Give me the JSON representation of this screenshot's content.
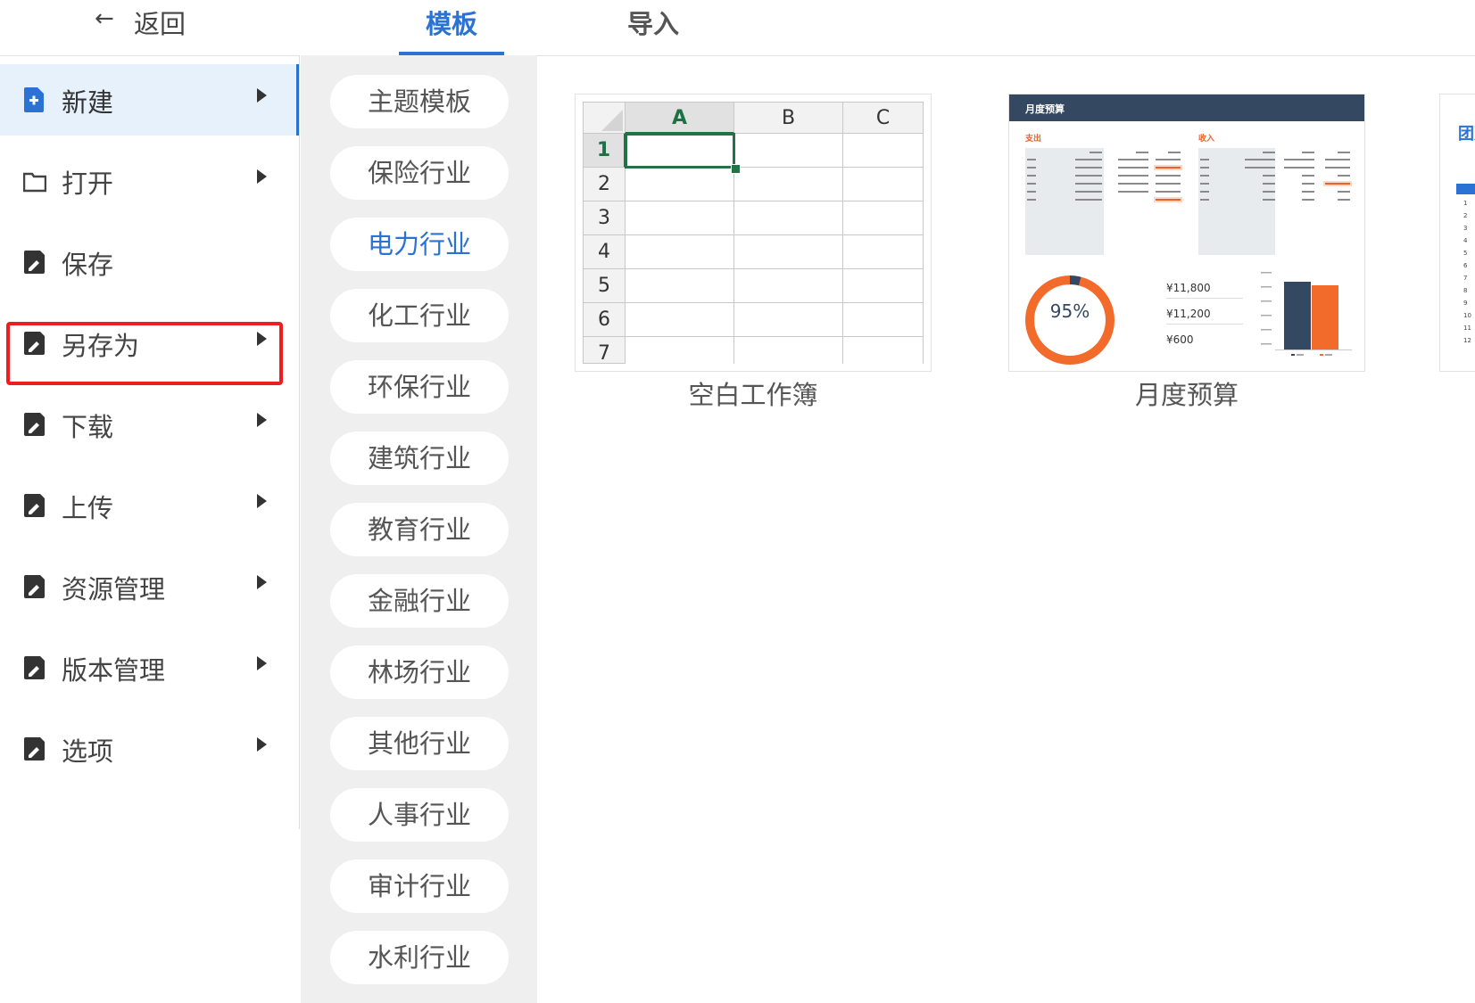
{
  "back": {
    "label": "返回"
  },
  "menu": [
    {
      "label": "新建",
      "icon": "file-add-icon",
      "active": true,
      "has_submenu": true
    },
    {
      "label": "打开",
      "icon": "folder-icon",
      "has_submenu": true
    },
    {
      "label": "保存",
      "icon": "save-icon",
      "has_submenu": false
    },
    {
      "label": "另存为",
      "icon": "save-icon",
      "has_submenu": true,
      "highlighted": true
    },
    {
      "label": "下载",
      "icon": "save-icon",
      "has_submenu": true
    },
    {
      "label": "上传",
      "icon": "save-icon",
      "has_submenu": true
    },
    {
      "label": "资源管理",
      "icon": "save-icon",
      "has_submenu": true
    },
    {
      "label": "版本管理",
      "icon": "save-icon",
      "has_submenu": true
    },
    {
      "label": "选项",
      "icon": "save-icon",
      "has_submenu": true
    }
  ],
  "tabs": {
    "templates": "模板",
    "import": "导入",
    "active": "templates"
  },
  "categories": [
    "主题模板",
    "保险行业",
    "电力行业",
    "化工行业",
    "环保行业",
    "建筑行业",
    "教育行业",
    "金融行业",
    "林场行业",
    "其他行业",
    "人事行业",
    "审计行业",
    "水利行业"
  ],
  "selected_category": "电力行业",
  "templates": [
    {
      "name": "空白工作簿",
      "columns": [
        "A",
        "B",
        "C"
      ],
      "rows": [
        "1",
        "2",
        "3",
        "4",
        "5",
        "6",
        "7"
      ]
    },
    {
      "name": "月度预算",
      "preview": {
        "title": "月度预算",
        "expense_label": "支出",
        "income_label": "收入",
        "donut_percent": "95%",
        "summary_values": [
          "¥11,800",
          "¥11,200",
          "¥600"
        ]
      }
    },
    {
      "name": "",
      "preview": {
        "title": "团建",
        "row_numbers": [
          "1",
          "2",
          "3",
          "4",
          "5",
          "6",
          "7",
          "8",
          "9",
          "10",
          "11",
          "12"
        ]
      }
    }
  ],
  "colors": {
    "accent": "#2a72d4",
    "highlight": "#ee1e1e",
    "budget_header": "#344861",
    "budget_orange": "#f26b2a"
  }
}
